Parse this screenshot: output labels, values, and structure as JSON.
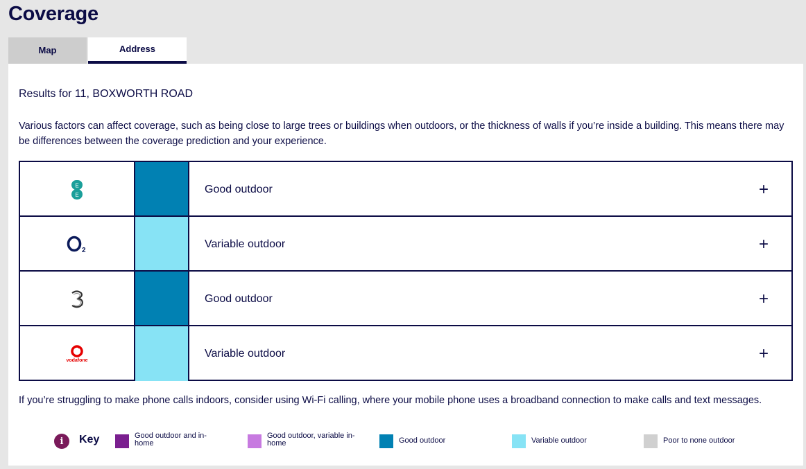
{
  "page": {
    "title": "Coverage"
  },
  "tabs": [
    {
      "label": "Map",
      "active": false
    },
    {
      "label": "Address",
      "active": true
    }
  ],
  "results": {
    "heading": "Results for 11, BOXWORTH ROAD",
    "intro": "Various factors can affect coverage, such as being close to large trees or buildings when outdoors, or the thickness of walls if you’re inside a building. This means there may be differences between the coverage prediction and your experience."
  },
  "operators": [
    {
      "name": "EE",
      "logo_icon": "ee-logo-icon",
      "status": "Good outdoor",
      "color": "#0181b3"
    },
    {
      "name": "O2",
      "logo_icon": "o2-logo-icon",
      "status": "Variable outdoor",
      "color": "#87e3f5"
    },
    {
      "name": "Three",
      "logo_icon": "three-logo-icon",
      "status": "Good outdoor",
      "color": "#0181b3"
    },
    {
      "name": "Vodafone",
      "logo_text": "vodafone",
      "logo_icon": "vodafone-logo-icon",
      "status": "Variable outdoor",
      "color": "#87e3f5"
    }
  ],
  "expand_symbol": "+",
  "wifi_note": "If you’re struggling to make phone calls indoors, consider using Wi-Fi calling, where your mobile phone uses a broadband connection to make calls and text messages.",
  "key": {
    "label": "Key",
    "info_symbol": "i",
    "items": [
      {
        "label": "Good outdoor and in-home",
        "color": "#7a1f8f"
      },
      {
        "label": "Good outdoor, variable in-home",
        "color": "#c77ae0"
      },
      {
        "label": "Good outdoor",
        "color": "#0181b3"
      },
      {
        "label": "Variable outdoor",
        "color": "#87e3f5"
      },
      {
        "label": "Poor to none outdoor",
        "color": "#d0d0d0"
      }
    ]
  }
}
